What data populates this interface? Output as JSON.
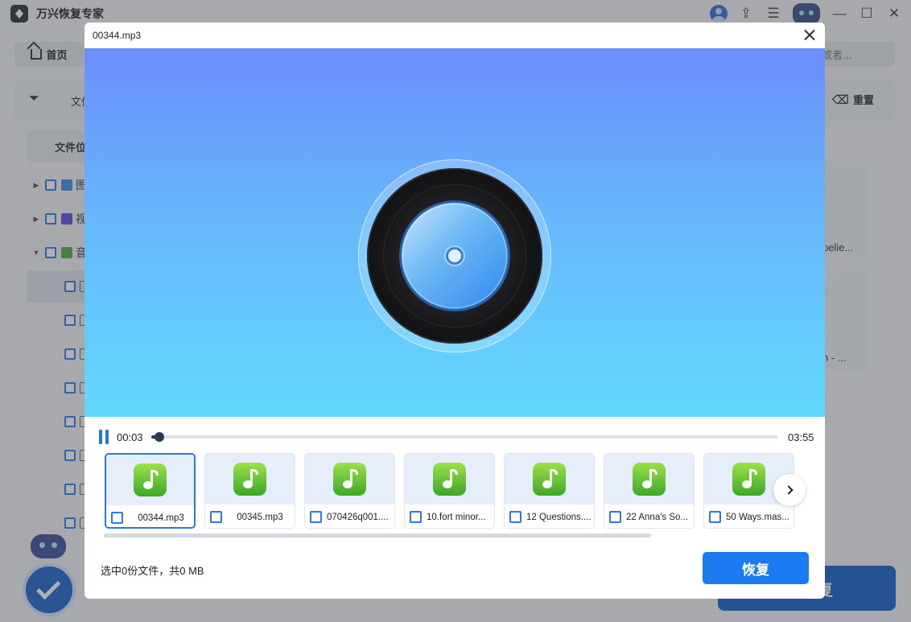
{
  "app": {
    "title": "万兴恢复专家"
  },
  "nav": {
    "home_label": "首页",
    "search_placeholder_fragment": "或者..."
  },
  "filter": {
    "label_fragment": "文件",
    "reset_label": "重置"
  },
  "sidebar": {
    "column_header": "文件位",
    "items": [
      {
        "label": "图",
        "icon_color": "#3d8fe8"
      },
      {
        "label": "视",
        "icon_color": "#5c4fe0"
      },
      {
        "label": "音",
        "icon_color": "#4bb43a"
      }
    ]
  },
  "background_cards": [
    {
      "label": "pelie..."
    },
    {
      "label": "h - ..."
    }
  ],
  "background_button": {
    "label": "复"
  },
  "modal": {
    "title": "00344.mp3",
    "player": {
      "current_time": "00:03",
      "total_time": "03:55",
      "progress": 0.013
    },
    "files": [
      {
        "name": "00344.mp3",
        "selected": true
      },
      {
        "name": "00345.mp3",
        "selected": false
      },
      {
        "name": "070426q001....",
        "selected": false
      },
      {
        "name": "10.fort minor...",
        "selected": false
      },
      {
        "name": "12 Questions....",
        "selected": false
      },
      {
        "name": "22 Anna's So...",
        "selected": false
      },
      {
        "name": "50 Ways.mas...",
        "selected": false
      }
    ],
    "status": "选中0份文件，共0 MB",
    "recover_label": "恢复"
  },
  "colors": {
    "accent": "#1b7cf2",
    "music_green": "#4bb43a"
  }
}
